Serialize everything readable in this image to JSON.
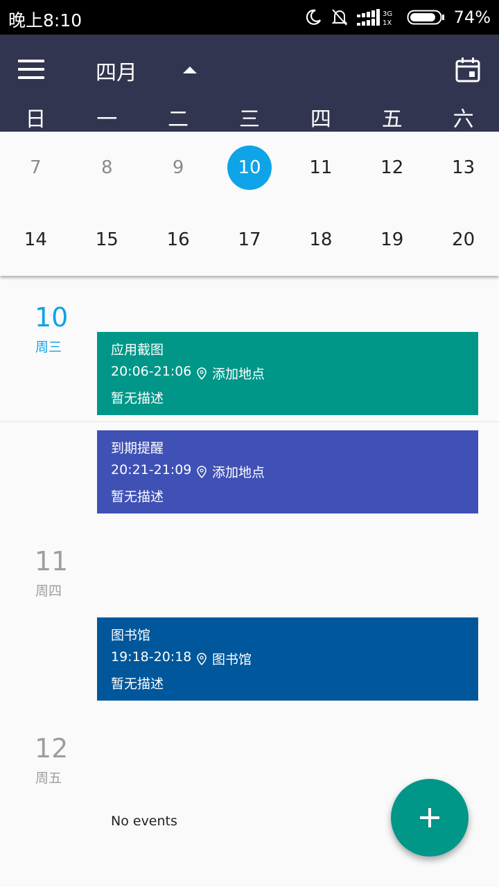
{
  "status_bar": {
    "time": "晚上8:10",
    "network": "3G 1X",
    "battery": "74%"
  },
  "header": {
    "month": "四月",
    "weekdays": [
      "日",
      "一",
      "二",
      "三",
      "四",
      "五",
      "六"
    ]
  },
  "calendar": {
    "week1": [
      "7",
      "8",
      "9",
      "10",
      "11",
      "12",
      "13"
    ],
    "week2": [
      "14",
      "15",
      "16",
      "17",
      "18",
      "19",
      "20"
    ]
  },
  "agenda": {
    "day10": {
      "date": "10",
      "weekday": "周三",
      "events": [
        {
          "title": "应用截图",
          "time": "20:06-21:06",
          "location": "添加地点",
          "description": "暂无描述",
          "color": "#009688"
        },
        {
          "title": "到期提醒",
          "time": "20:21-21:09",
          "location": "添加地点",
          "description": "暂无描述",
          "color": "#3f51b5"
        }
      ]
    },
    "day11": {
      "date": "11",
      "weekday": "周四",
      "events": [
        {
          "title": "图书馆",
          "time": "19:18-20:18",
          "location": "图书馆",
          "description": "暂无描述",
          "color": "#01579b"
        }
      ]
    },
    "day12": {
      "date": "12",
      "weekday": "周五",
      "empty_text": "No events"
    }
  },
  "colors": {
    "accent": "#0fa3e8",
    "appbar": "#323550",
    "fab": "#009688"
  }
}
